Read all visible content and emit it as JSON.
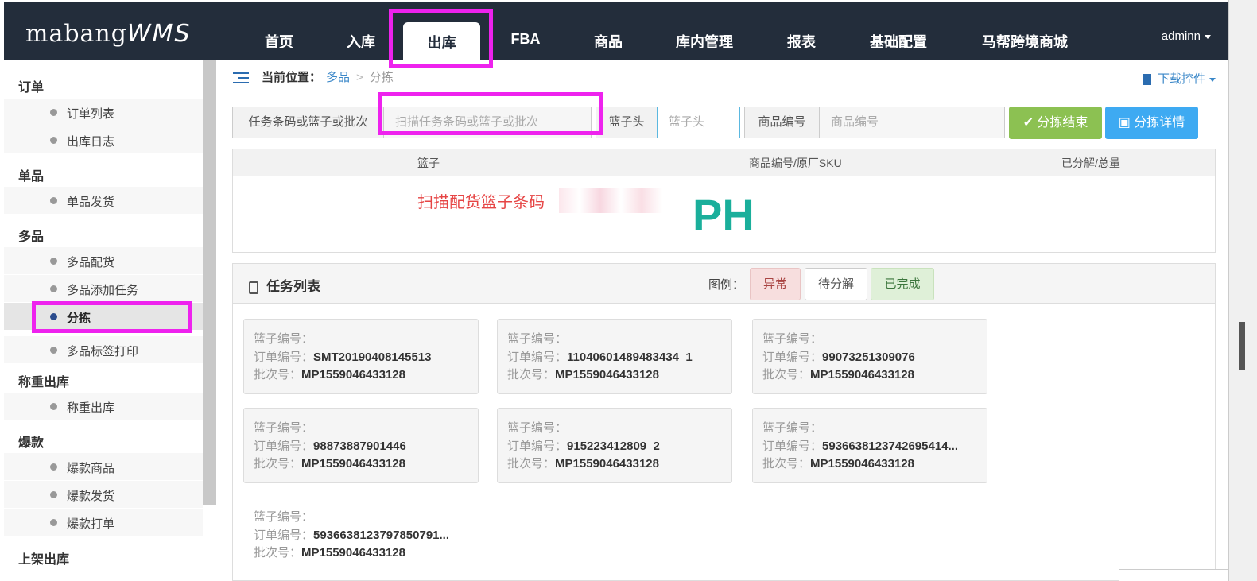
{
  "logo": {
    "main": "mabang",
    "suffix": "WMS"
  },
  "nav": [
    {
      "label": "首页"
    },
    {
      "label": "入库"
    },
    {
      "label": "出库"
    },
    {
      "label": "FBA"
    },
    {
      "label": "商品"
    },
    {
      "label": "库内管理"
    },
    {
      "label": "报表"
    },
    {
      "label": "基础配置"
    },
    {
      "label": "马帮跨境商城"
    }
  ],
  "user": {
    "name": "adminn"
  },
  "sidebar": {
    "groups": [
      "订单",
      "单品",
      "多品",
      "称重出库",
      "爆款",
      "上架出库"
    ],
    "items": [
      "订单列表",
      "出库日志",
      "单品发货",
      "多品配货",
      "多品添加任务",
      "分拣",
      "多品标签打印",
      "称重出库",
      "爆款商品",
      "爆款发货",
      "爆款打单"
    ]
  },
  "breadcrumb": {
    "label": "当前位置：",
    "parent": "多品",
    "sep": ">",
    "current": "分拣"
  },
  "download": {
    "label": "下载控件"
  },
  "search": {
    "task_label": "任务条码或篮子或批次",
    "task_placeholder": "扫描任务条码或篮子或批次",
    "basket_label": "篮子头",
    "basket_placeholder": "篮子头",
    "sku_label": "商品编号",
    "sku_placeholder": "商品编号",
    "finish_button": "分拣结束",
    "detail_button": "分拣详情"
  },
  "table": {
    "headers": [
      "篮子",
      "商品编号/原厂SKU",
      "已分解/总量"
    ],
    "scan_message": "扫描配货篮子条码",
    "big_code": "PH"
  },
  "tasks": {
    "title": "任务列表",
    "legend_label": "图例：",
    "legend": [
      "异常",
      "待分解",
      "已完成"
    ],
    "field_labels": {
      "basket": "篮子编号：",
      "order": "订单编号：",
      "batch": "批次号："
    },
    "cards": [
      {
        "basket": "",
        "order": "SMT20190408145513",
        "batch": "MP1559046433128"
      },
      {
        "basket": "",
        "order": "11040601489483434_1",
        "batch": "MP1559046433128"
      },
      {
        "basket": "",
        "order": "99073251309076",
        "batch": "MP1559046433128"
      },
      {
        "basket": "",
        "order": "98873887901446",
        "batch": "MP1559046433128"
      },
      {
        "basket": "",
        "order": "915223412809_2",
        "batch": "MP1559046433128"
      },
      {
        "basket": "",
        "order": "5936638123742695414...",
        "batch": "MP1559046433128"
      },
      {
        "basket": "",
        "order": "5936638123797850791...",
        "batch": "MP1559046433128"
      }
    ]
  },
  "colors": {
    "nav_bg": "#232d3b",
    "highlight": "#ee22ee",
    "accent_green": "#8cc152",
    "accent_blue": "#3eaaf2",
    "link": "#3a87c8",
    "ph": "#1aaf9b",
    "scan_msg": "#e64545"
  }
}
